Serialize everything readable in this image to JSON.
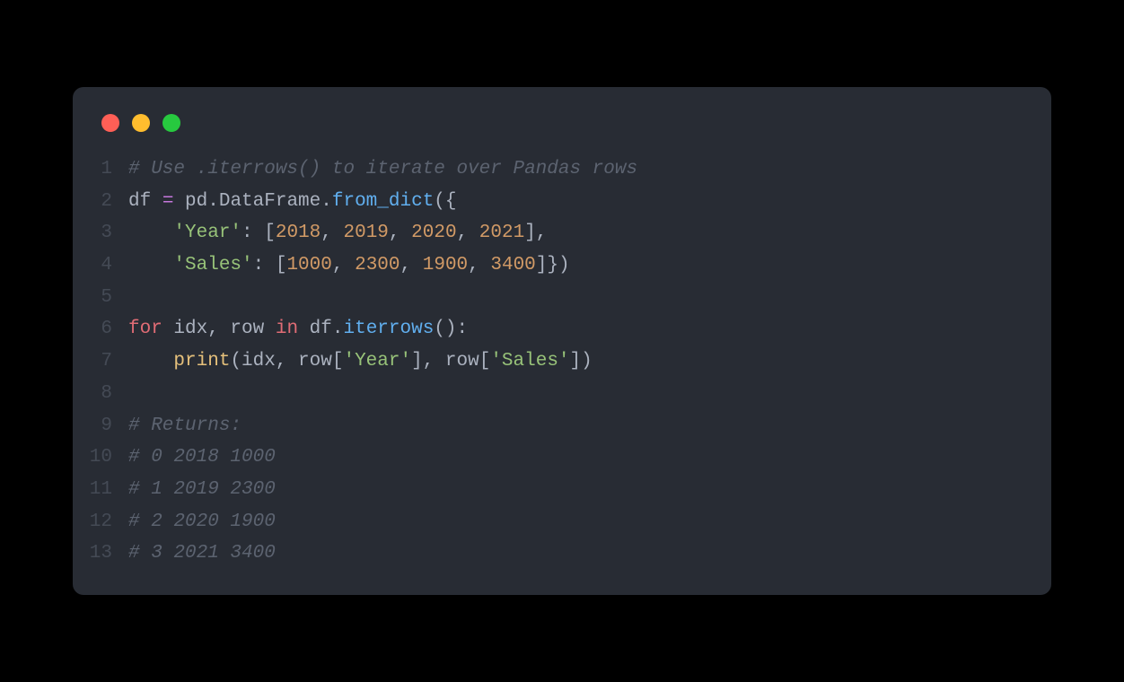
{
  "lines": {
    "ln1": "1",
    "ln2": "2",
    "ln3": "3",
    "ln4": "4",
    "ln5": "5",
    "ln6": "6",
    "ln7": "7",
    "ln8": "8",
    "ln9": "9",
    "ln10": "10",
    "ln11": "11",
    "ln12": "12",
    "ln13": "13"
  },
  "code": {
    "l1_comment": "# Use .iterrows() to iterate over Pandas rows",
    "l2_df": "df ",
    "l2_eq": "=",
    "l2_pd": " pd",
    "l2_dot1": ".",
    "l2_dataframe": "DataFrame",
    "l2_dot2": ".",
    "l2_fromdict": "from_dict",
    "l2_open": "({",
    "l3_indent": "    ",
    "l3_year": "'Year'",
    "l3_colon": ": [",
    "l3_n1": "2018",
    "l3_c1": ", ",
    "l3_n2": "2019",
    "l3_c2": ", ",
    "l3_n3": "2020",
    "l3_c3": ", ",
    "l3_n4": "2021",
    "l3_close": "],",
    "l4_indent": "    ",
    "l4_sales": "'Sales'",
    "l4_colon": ": [",
    "l4_n1": "1000",
    "l4_c1": ", ",
    "l4_n2": "2300",
    "l4_c2": ", ",
    "l4_n3": "1900",
    "l4_c3": ", ",
    "l4_n4": "3400",
    "l4_close": "]})",
    "l5_empty": "",
    "l6_for": "for",
    "l6_idxrow": " idx, row ",
    "l6_in": "in",
    "l6_df": " df",
    "l6_dot": ".",
    "l6_iterrows": "iterrows",
    "l6_close": "():",
    "l7_indent": "    ",
    "l7_print": "print",
    "l7_open": "(idx, row[",
    "l7_year": "'Year'",
    "l7_mid": "], row[",
    "l7_sales": "'Sales'",
    "l7_close": "])",
    "l8_empty": "",
    "l9_comment": "# Returns:",
    "l10_comment": "# 0 2018 1000",
    "l11_comment": "# 1 2019 2300",
    "l12_comment": "# 2 2020 1900",
    "l13_comment": "# 3 2021 3400"
  }
}
